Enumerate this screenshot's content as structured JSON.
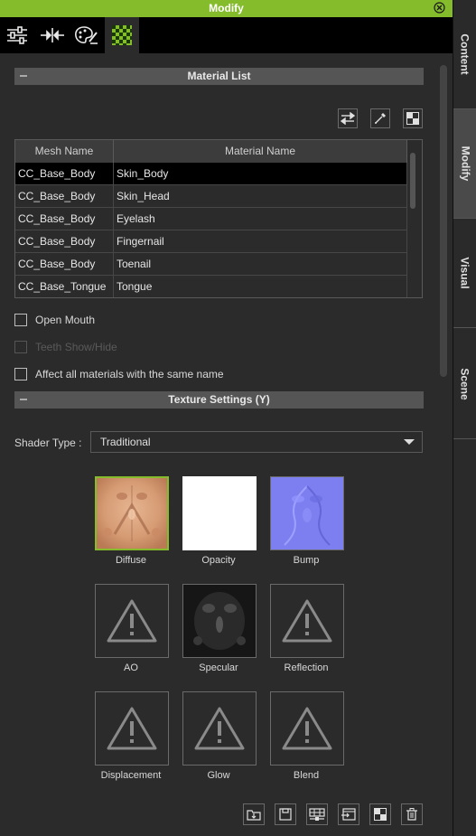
{
  "window": {
    "title": "Modify"
  },
  "side_tabs": [
    {
      "label": "Content"
    },
    {
      "label": "Modify"
    },
    {
      "label": "Visual"
    },
    {
      "label": "Scene"
    }
  ],
  "material_list": {
    "section_title": "Material List",
    "columns": [
      "Mesh Name",
      "Material Name"
    ],
    "rows": [
      {
        "mesh": "CC_Base_Body",
        "material": "Skin_Body"
      },
      {
        "mesh": "CC_Base_Body",
        "material": "Skin_Head"
      },
      {
        "mesh": "CC_Base_Body",
        "material": "Eyelash"
      },
      {
        "mesh": "CC_Base_Body",
        "material": "Fingernail"
      },
      {
        "mesh": "CC_Base_Body",
        "material": "Toenail"
      },
      {
        "mesh": "CC_Base_Tongue",
        "material": "Tongue"
      }
    ],
    "selected_row": 0
  },
  "options": {
    "open_mouth": "Open Mouth",
    "teeth_show_hide": "Teeth Show/Hide",
    "affect_all": "Affect all materials with the same name"
  },
  "texture_settings": {
    "section_title": "Texture Settings  (Y)",
    "shader_label": "Shader Type :",
    "shader_value": "Traditional",
    "slots": [
      {
        "label": "Diffuse",
        "kind": "diffuse"
      },
      {
        "label": "Opacity",
        "kind": "white"
      },
      {
        "label": "Bump",
        "kind": "bump"
      },
      {
        "label": "AO",
        "kind": "warning"
      },
      {
        "label": "Specular",
        "kind": "specular"
      },
      {
        "label": "Reflection",
        "kind": "warning"
      },
      {
        "label": "Displacement",
        "kind": "warning"
      },
      {
        "label": "Glow",
        "kind": "warning"
      },
      {
        "label": "Blend",
        "kind": "warning"
      }
    ]
  },
  "colors": {
    "accent": "#84bc2c",
    "panel": "#2b2b2b",
    "header": "#555555"
  }
}
